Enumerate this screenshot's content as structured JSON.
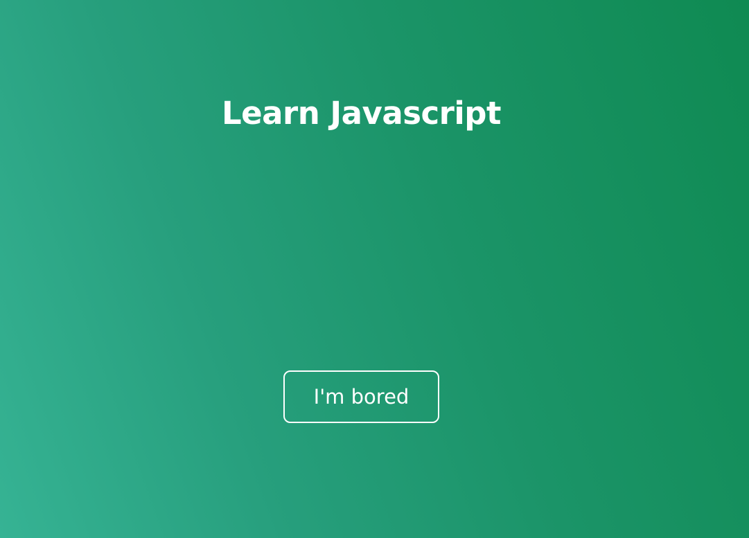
{
  "page": {
    "title": "Learn Javascript",
    "button_label": "I'm bored"
  },
  "colors": {
    "background_start": "#36b394",
    "background_end": "#0f8a52",
    "text": "#ffffff"
  }
}
